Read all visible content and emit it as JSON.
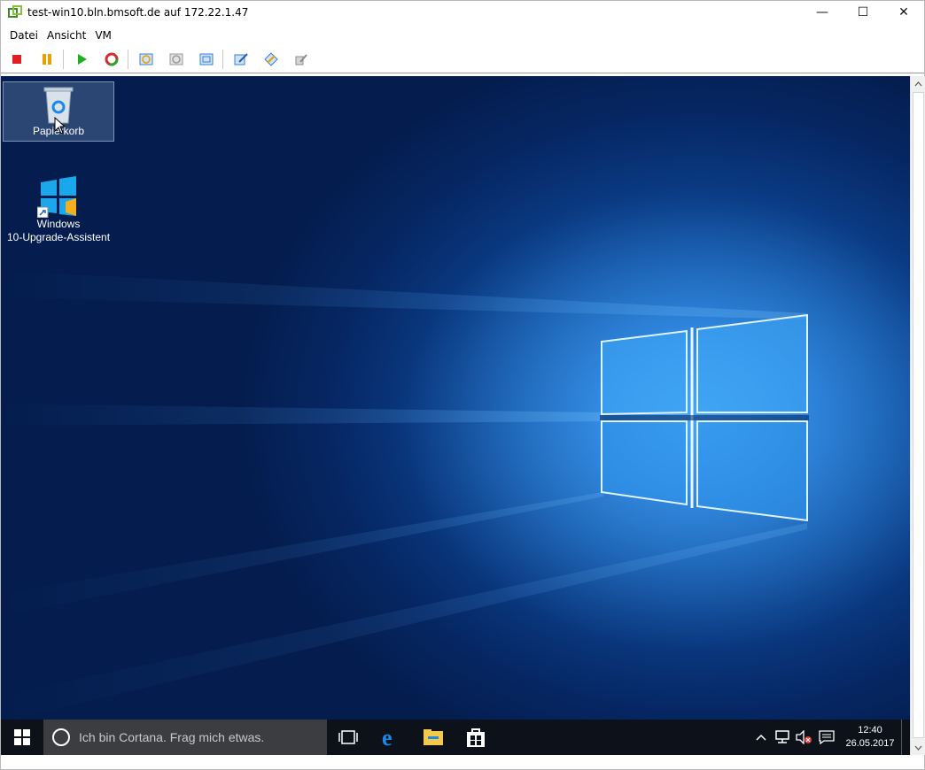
{
  "window": {
    "title": "test-win10.bln.bmsoft.de auf 172.22.1.47",
    "minimize_glyph": "—",
    "maximize_glyph": "☐",
    "close_glyph": "✕"
  },
  "menu": {
    "items": [
      "Datei",
      "Ansicht",
      "VM"
    ]
  },
  "toolbar": {
    "buttons": [
      {
        "icon": "stop-icon",
        "color": "#e02020"
      },
      {
        "icon": "pause-icon",
        "color": "#e8a000"
      },
      {
        "icon": "play-icon",
        "color": "#1fae1f"
      },
      {
        "icon": "reset-icon",
        "color": "#d03030"
      },
      {
        "icon": "snapshot-icon",
        "color": "#3a7fd5"
      },
      {
        "icon": "revert-snapshot-icon",
        "color": "#9a9a9a"
      },
      {
        "icon": "snapshot-manager-icon",
        "color": "#3a7fd5"
      },
      {
        "icon": "edit-settings-icon",
        "color": "#3a7fd5"
      },
      {
        "icon": "install-tools-icon",
        "color": "#3a7fd5"
      },
      {
        "icon": "config-icon",
        "color": "#9a9a9a"
      }
    ]
  },
  "desktop": {
    "icons": [
      {
        "label": "Papierkorb",
        "icon": "recycle-bin-icon"
      },
      {
        "label_line1": "Windows",
        "label_line2": "10-Upgrade-Assistent",
        "icon": "windows-upgrade-icon"
      }
    ]
  },
  "taskbar": {
    "cortana_placeholder": "Ich bin Cortana. Frag mich etwas.",
    "clock_time": "12:40",
    "clock_date": "26.05.2017"
  },
  "colors": {
    "accent": "#0078d7",
    "taskbar": "#0c111a",
    "cortana_box": "#3b3d41"
  }
}
